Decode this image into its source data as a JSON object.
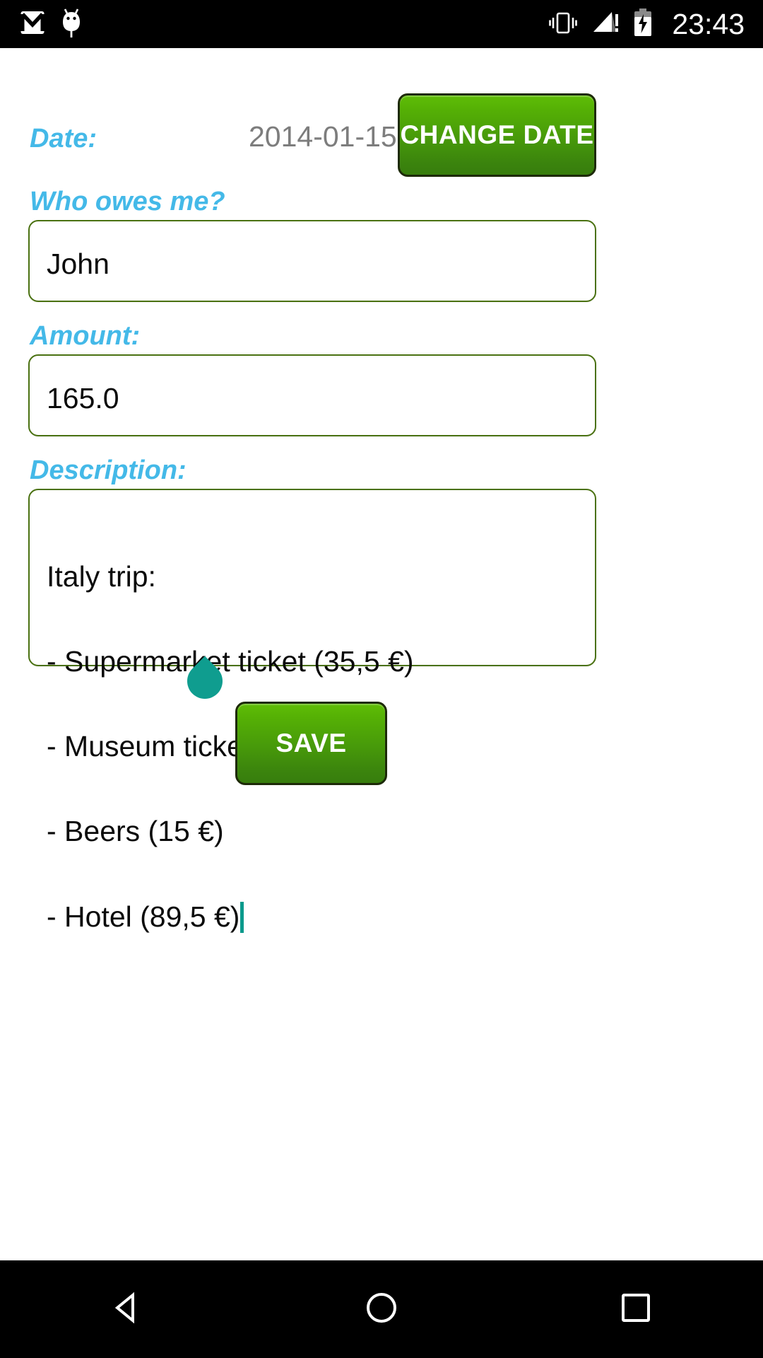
{
  "status_bar": {
    "icons_left": [
      "gmail-icon",
      "android-bug-icon"
    ],
    "icons_right": [
      "vibrate-icon",
      "signal-warning-icon",
      "battery-charging-icon"
    ],
    "clock": "23:43",
    "background_color": "#000000",
    "foreground_color": "#ffffff"
  },
  "theme": {
    "label_accent": "#44b9e8",
    "field_border": "#4a7111",
    "button_green_top": "#5fbd06",
    "button_green_bottom": "#377d0d",
    "caret_color": "#0b9a8c",
    "value_text": "#0a0a0a",
    "date_value_text": "#7d7d7d"
  },
  "form": {
    "date": {
      "label": "Date:",
      "value": "2014-01-15",
      "change_button_label": "CHANGE DATE"
    },
    "who_owes": {
      "label": "Who owes me?",
      "value": "John",
      "placeholder": "Who owes me?"
    },
    "amount": {
      "label": "Amount:",
      "value": "165.0",
      "placeholder": "Amount"
    },
    "description": {
      "label": "Description:",
      "placeholder": "Description",
      "lines": [
        "Italy trip:",
        "- Supermarket ticket (35,5 €)",
        "- Museum ticket (25 €)",
        "- Beers (15 €)",
        "- Hotel (89,5 €)"
      ],
      "value": "Italy trip:\n- Supermarket ticket (35,5 €)\n- Museum ticket (25 €)\n- Beers (15 €)\n- Hotel (89,5 €)",
      "caret_present": true
    },
    "save_button_label": "SAVE"
  },
  "navigation_bar": {
    "back_icon": "back-triangle-icon",
    "home_icon": "home-circle-icon",
    "recents_icon": "recents-square-icon",
    "background_color": "#000000"
  }
}
